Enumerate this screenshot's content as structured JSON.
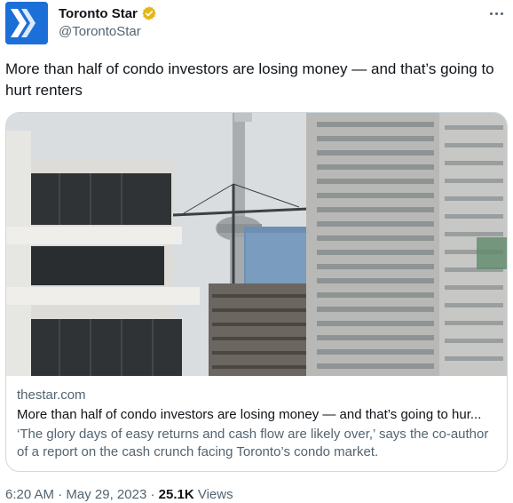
{
  "author": {
    "display_name": "Toronto Star",
    "handle": "@TorontoStar",
    "verified_badge": "gold-verified-icon",
    "avatar_icon": "toronto-star-logo",
    "brand_color": "#1d6fd8"
  },
  "tweet": {
    "text": "More than half of condo investors are losing money — and that’s going to hurt renters"
  },
  "card": {
    "image_alt": "",
    "domain": "thestar.com",
    "title": "More than half of condo investors are losing money — and that’s going to hur...",
    "description": "‘The glory days of easy returns and cash flow are likely over,’ says the co-author of a report on the cash crunch facing Toronto’s condo market."
  },
  "meta": {
    "time": "6:20 AM",
    "separator_1": " · ",
    "date": "May 29, 2023",
    "separator_2": " · ",
    "views_count": "25.1K",
    "views_label": " Views"
  },
  "colors": {
    "text_primary": "#0f1419",
    "text_secondary": "#536471",
    "border": "#cfd9de",
    "verified_gold": "#e2b719"
  }
}
